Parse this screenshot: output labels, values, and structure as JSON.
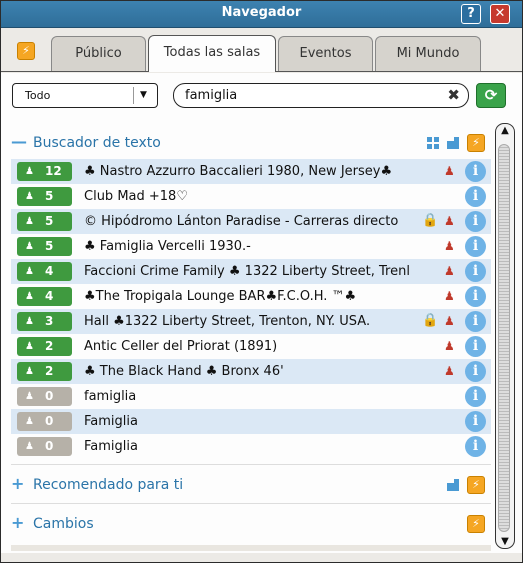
{
  "window": {
    "title": "Navegador",
    "help_label": "?",
    "close_label": "✕"
  },
  "tabs": {
    "bolt_label": "⚡",
    "items": [
      {
        "label": "Público"
      },
      {
        "label": "Todas las salas"
      },
      {
        "label": "Eventos"
      },
      {
        "label": "Mi Mundo"
      }
    ],
    "active": "Todas las salas"
  },
  "filter": {
    "select_value": "Todo",
    "select_arrow": "▼",
    "search_value": "famiglia",
    "clear_label": "✖",
    "refresh_label": "⟳"
  },
  "sections": {
    "search": {
      "sign": "—",
      "title": "Buscador de texto",
      "bolt": "⚡"
    },
    "recommended": {
      "sign": "+",
      "title": "Recomendado para ti",
      "bolt": "⚡"
    },
    "changes": {
      "sign": "+",
      "title": "Cambios",
      "bolt": "⚡"
    }
  },
  "rooms": [
    {
      "count": "12",
      "name": "♣ Nastro Azzurro Baccalieri 1980, New Jersey♣",
      "status": "green",
      "lock": "",
      "group": "♟"
    },
    {
      "count": "5",
      "name": "Club Mad +18♡",
      "status": "green",
      "lock": "",
      "group": ""
    },
    {
      "count": "5",
      "name": "© Hipódromo Lánton Paradise - Carreras directo",
      "status": "green",
      "lock": "🔒",
      "group": "♟"
    },
    {
      "count": "5",
      "name": "♣ Famiglia Vercelli 1930.-",
      "status": "green",
      "lock": "",
      "group": "♟"
    },
    {
      "count": "4",
      "name": "Faccioni Crime Family ♣ 1322 Liberty Street, Trenl",
      "status": "green",
      "lock": "",
      "group": "♟"
    },
    {
      "count": "4",
      "name": "♣The Tropigala Lounge BAR♣F.C.O.H. ™♣",
      "status": "green",
      "lock": "",
      "group": "♟"
    },
    {
      "count": "3",
      "name": "Hall ♣1322 Liberty Street, Trenton, NY. USA.",
      "status": "green",
      "lock": "🔒",
      "group": "♟"
    },
    {
      "count": "2",
      "name": "Antic Celler del Priorat (1891)",
      "status": "green",
      "lock": "",
      "group": "♟"
    },
    {
      "count": "2",
      "name": "♣ The Black Hand ♣ Bronx 46'",
      "status": "green",
      "lock": "",
      "group": "♟"
    },
    {
      "count": "0",
      "name": "famiglia",
      "status": "grey",
      "lock": "",
      "group": ""
    },
    {
      "count": "0",
      "name": "Famiglia",
      "status": "grey",
      "lock": "",
      "group": ""
    },
    {
      "count": "0",
      "name": "Famiglia",
      "status": "grey",
      "lock": "",
      "group": ""
    }
  ],
  "icons": {
    "person": "♟",
    "info": "i"
  },
  "colors": {
    "title_bar": "#3a7eab",
    "badge_green": "#3f9a3f",
    "badge_grey": "#b6b1a8",
    "accent_blue": "#2a74a8",
    "row_alt": "#dbe8f5",
    "bolt_orange": "#f5a623"
  }
}
